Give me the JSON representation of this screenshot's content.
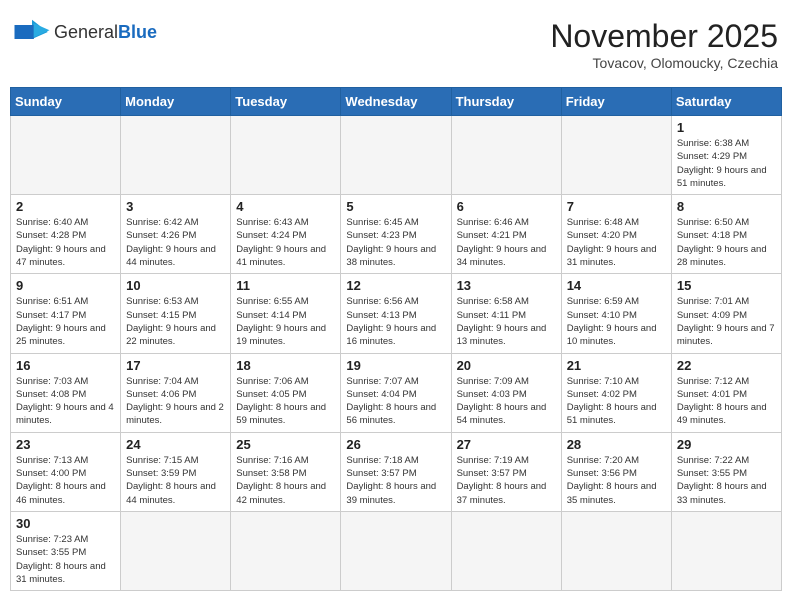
{
  "header": {
    "logo_general": "General",
    "logo_blue": "Blue",
    "title": "November 2025",
    "subtitle": "Tovacov, Olomoucky, Czechia"
  },
  "days_of_week": [
    "Sunday",
    "Monday",
    "Tuesday",
    "Wednesday",
    "Thursday",
    "Friday",
    "Saturday"
  ],
  "weeks": [
    [
      {
        "day": "",
        "info": ""
      },
      {
        "day": "",
        "info": ""
      },
      {
        "day": "",
        "info": ""
      },
      {
        "day": "",
        "info": ""
      },
      {
        "day": "",
        "info": ""
      },
      {
        "day": "",
        "info": ""
      },
      {
        "day": "1",
        "info": "Sunrise: 6:38 AM\nSunset: 4:29 PM\nDaylight: 9 hours and 51 minutes."
      }
    ],
    [
      {
        "day": "2",
        "info": "Sunrise: 6:40 AM\nSunset: 4:28 PM\nDaylight: 9 hours and 47 minutes."
      },
      {
        "day": "3",
        "info": "Sunrise: 6:42 AM\nSunset: 4:26 PM\nDaylight: 9 hours and 44 minutes."
      },
      {
        "day": "4",
        "info": "Sunrise: 6:43 AM\nSunset: 4:24 PM\nDaylight: 9 hours and 41 minutes."
      },
      {
        "day": "5",
        "info": "Sunrise: 6:45 AM\nSunset: 4:23 PM\nDaylight: 9 hours and 38 minutes."
      },
      {
        "day": "6",
        "info": "Sunrise: 6:46 AM\nSunset: 4:21 PM\nDaylight: 9 hours and 34 minutes."
      },
      {
        "day": "7",
        "info": "Sunrise: 6:48 AM\nSunset: 4:20 PM\nDaylight: 9 hours and 31 minutes."
      },
      {
        "day": "8",
        "info": "Sunrise: 6:50 AM\nSunset: 4:18 PM\nDaylight: 9 hours and 28 minutes."
      }
    ],
    [
      {
        "day": "9",
        "info": "Sunrise: 6:51 AM\nSunset: 4:17 PM\nDaylight: 9 hours and 25 minutes."
      },
      {
        "day": "10",
        "info": "Sunrise: 6:53 AM\nSunset: 4:15 PM\nDaylight: 9 hours and 22 minutes."
      },
      {
        "day": "11",
        "info": "Sunrise: 6:55 AM\nSunset: 4:14 PM\nDaylight: 9 hours and 19 minutes."
      },
      {
        "day": "12",
        "info": "Sunrise: 6:56 AM\nSunset: 4:13 PM\nDaylight: 9 hours and 16 minutes."
      },
      {
        "day": "13",
        "info": "Sunrise: 6:58 AM\nSunset: 4:11 PM\nDaylight: 9 hours and 13 minutes."
      },
      {
        "day": "14",
        "info": "Sunrise: 6:59 AM\nSunset: 4:10 PM\nDaylight: 9 hours and 10 minutes."
      },
      {
        "day": "15",
        "info": "Sunrise: 7:01 AM\nSunset: 4:09 PM\nDaylight: 9 hours and 7 minutes."
      }
    ],
    [
      {
        "day": "16",
        "info": "Sunrise: 7:03 AM\nSunset: 4:08 PM\nDaylight: 9 hours and 4 minutes."
      },
      {
        "day": "17",
        "info": "Sunrise: 7:04 AM\nSunset: 4:06 PM\nDaylight: 9 hours and 2 minutes."
      },
      {
        "day": "18",
        "info": "Sunrise: 7:06 AM\nSunset: 4:05 PM\nDaylight: 8 hours and 59 minutes."
      },
      {
        "day": "19",
        "info": "Sunrise: 7:07 AM\nSunset: 4:04 PM\nDaylight: 8 hours and 56 minutes."
      },
      {
        "day": "20",
        "info": "Sunrise: 7:09 AM\nSunset: 4:03 PM\nDaylight: 8 hours and 54 minutes."
      },
      {
        "day": "21",
        "info": "Sunrise: 7:10 AM\nSunset: 4:02 PM\nDaylight: 8 hours and 51 minutes."
      },
      {
        "day": "22",
        "info": "Sunrise: 7:12 AM\nSunset: 4:01 PM\nDaylight: 8 hours and 49 minutes."
      }
    ],
    [
      {
        "day": "23",
        "info": "Sunrise: 7:13 AM\nSunset: 4:00 PM\nDaylight: 8 hours and 46 minutes."
      },
      {
        "day": "24",
        "info": "Sunrise: 7:15 AM\nSunset: 3:59 PM\nDaylight: 8 hours and 44 minutes."
      },
      {
        "day": "25",
        "info": "Sunrise: 7:16 AM\nSunset: 3:58 PM\nDaylight: 8 hours and 42 minutes."
      },
      {
        "day": "26",
        "info": "Sunrise: 7:18 AM\nSunset: 3:57 PM\nDaylight: 8 hours and 39 minutes."
      },
      {
        "day": "27",
        "info": "Sunrise: 7:19 AM\nSunset: 3:57 PM\nDaylight: 8 hours and 37 minutes."
      },
      {
        "day": "28",
        "info": "Sunrise: 7:20 AM\nSunset: 3:56 PM\nDaylight: 8 hours and 35 minutes."
      },
      {
        "day": "29",
        "info": "Sunrise: 7:22 AM\nSunset: 3:55 PM\nDaylight: 8 hours and 33 minutes."
      }
    ],
    [
      {
        "day": "30",
        "info": "Sunrise: 7:23 AM\nSunset: 3:55 PM\nDaylight: 8 hours and 31 minutes."
      },
      {
        "day": "",
        "info": ""
      },
      {
        "day": "",
        "info": ""
      },
      {
        "day": "",
        "info": ""
      },
      {
        "day": "",
        "info": ""
      },
      {
        "day": "",
        "info": ""
      },
      {
        "day": "",
        "info": ""
      }
    ]
  ]
}
